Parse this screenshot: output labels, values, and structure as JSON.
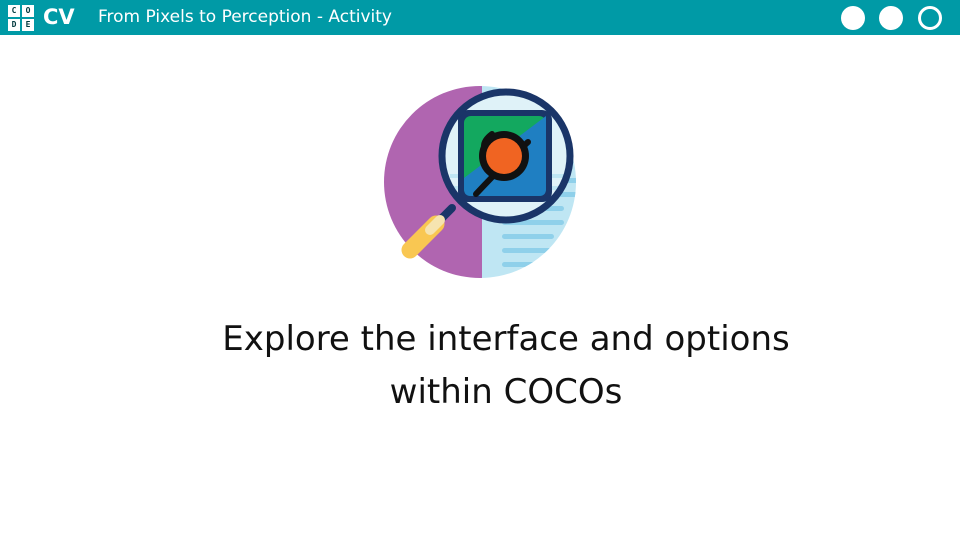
{
  "header": {
    "logo_letters": [
      "C",
      "O",
      "D",
      "E"
    ],
    "brand": "CV",
    "title": "From Pixels to Perception - Activity",
    "nav_dots": [
      {
        "style": "filled"
      },
      {
        "style": "filled"
      },
      {
        "style": "outline"
      }
    ],
    "colors": {
      "bar": "#009aa6",
      "text": "#ffffff"
    }
  },
  "illustration": {
    "icon": "magnifier-inspecting-image-icon",
    "colors": {
      "left_half": "#b065b0",
      "right_half": "#bfe6f3",
      "frame": "#1a3568",
      "handle": "#f9c752",
      "image_green": "#13a85f",
      "image_blue": "#1f7fc2",
      "image_dot": "#f06422"
    }
  },
  "main": {
    "line1": "Explore the interface and options",
    "line2": "within COCOs"
  }
}
